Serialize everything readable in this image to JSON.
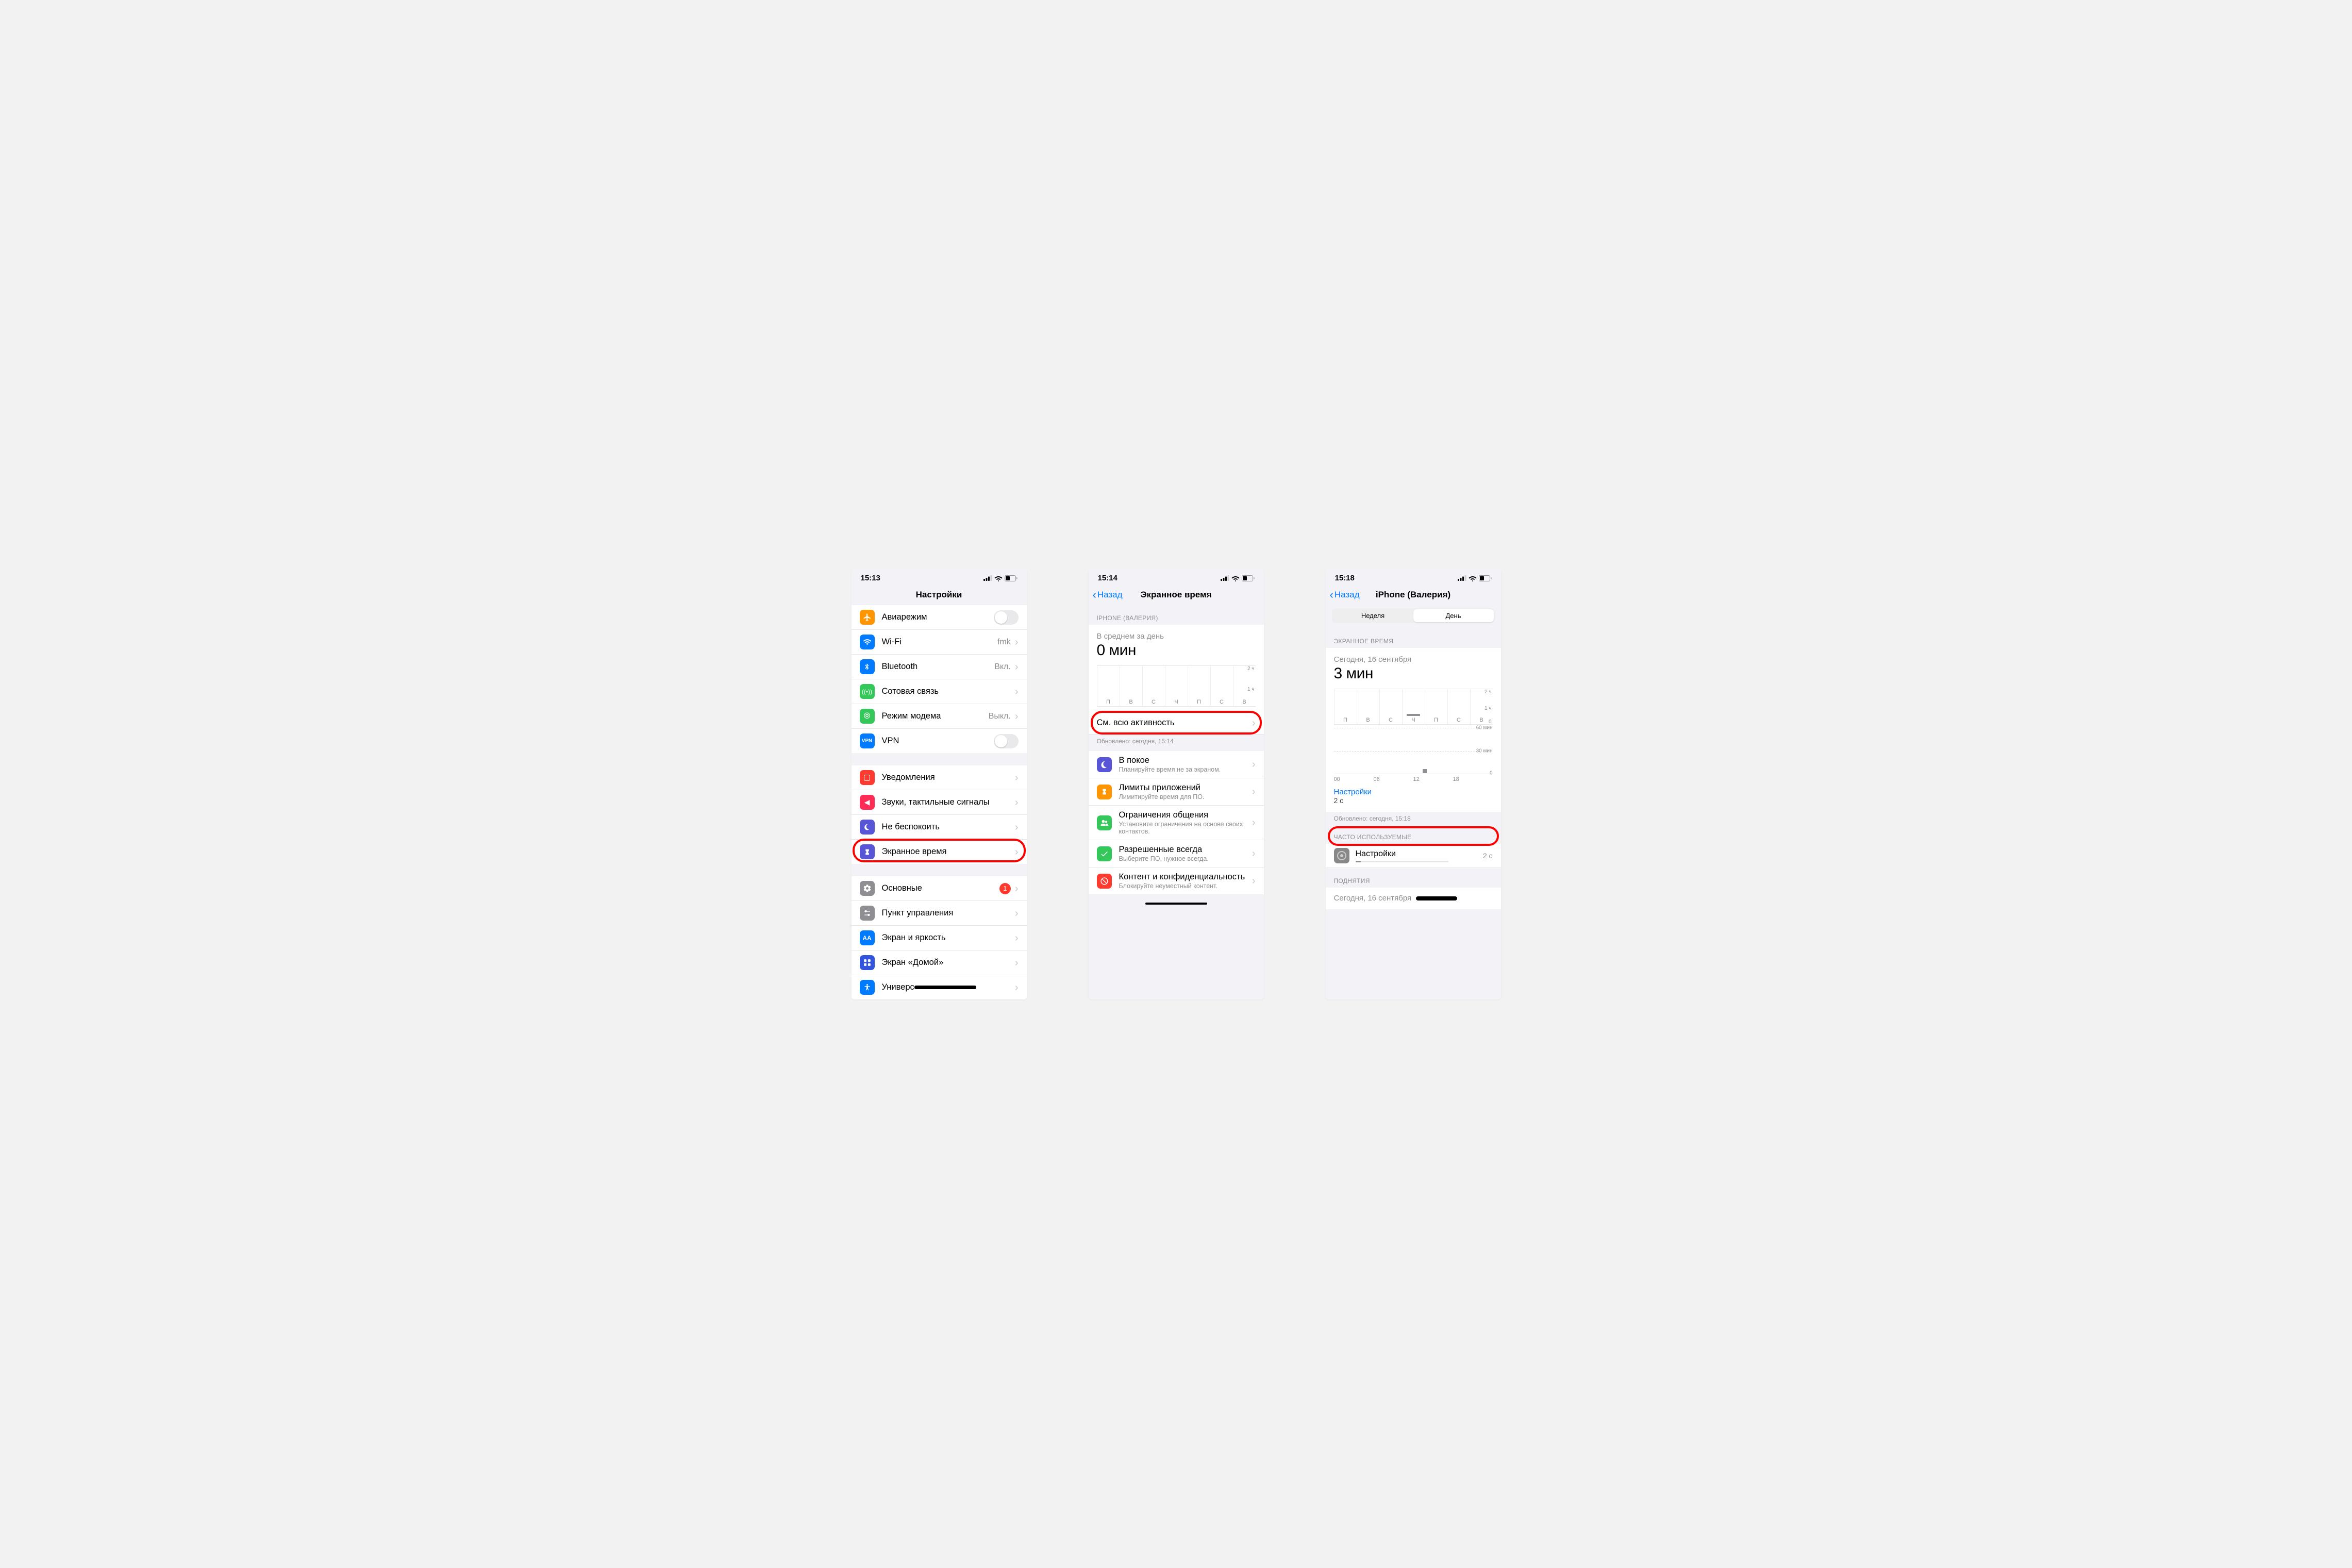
{
  "p1": {
    "time": "15:13",
    "title": "Настройки",
    "group1": [
      {
        "icon": "airplane",
        "color": "#ff9500",
        "label": "Авиарежим",
        "type": "toggle"
      },
      {
        "icon": "wifi",
        "color": "#007aff",
        "label": "Wi-Fi",
        "value": "fmk",
        "chev": true
      },
      {
        "icon": "bluetooth",
        "color": "#007aff",
        "label": "Bluetooth",
        "value": "Вкл.",
        "chev": true
      },
      {
        "icon": "antenna",
        "color": "#34c759",
        "label": "Сотовая связь",
        "chev": true
      },
      {
        "icon": "link",
        "color": "#34c759",
        "label": "Режим модема",
        "value": "Выкл.",
        "chev": true
      },
      {
        "icon": "vpn",
        "color": "#007aff",
        "label": "VPN",
        "type": "toggle"
      }
    ],
    "group2": [
      {
        "icon": "bell",
        "color": "#ff3b30",
        "label": "Уведомления",
        "chev": true
      },
      {
        "icon": "sound",
        "color": "#ff2d55",
        "label": "Звуки, тактильные сигналы",
        "chev": true
      },
      {
        "icon": "moon",
        "color": "#5856d6",
        "label": "Не беспокоить",
        "chev": true
      },
      {
        "icon": "hourglass",
        "color": "#5856d6",
        "label": "Экранное время",
        "chev": true,
        "highlight": true
      }
    ],
    "group3": [
      {
        "icon": "gear",
        "color": "#8e8e93",
        "label": "Основные",
        "badge": "1",
        "chev": true
      },
      {
        "icon": "toggles",
        "color": "#8e8e93",
        "label": "Пункт управления",
        "chev": true
      },
      {
        "icon": "aa",
        "color": "#007aff",
        "label": "Экран и яркость",
        "chev": true
      },
      {
        "icon": "grid",
        "color": "#3355dd",
        "label": "Экран «Домой»",
        "chev": true
      },
      {
        "icon": "access",
        "color": "#007aff",
        "label": "Универсальный доступ",
        "chev": true,
        "redact": true
      }
    ]
  },
  "p2": {
    "time": "15:14",
    "back": "Назад",
    "title": "Экранное время",
    "section_header": "IPHONE (ВАЛЕРИЯ)",
    "avg_label": "В среднем за день",
    "avg_value": "0 мин",
    "days": [
      "П",
      "В",
      "С",
      "Ч",
      "П",
      "С",
      "В"
    ],
    "y_ticks": [
      "2 ч",
      "1 ч"
    ],
    "see_all": "См. всю активность",
    "updated": "Обновлено: сегодня, 15:14",
    "features": [
      {
        "icon": "moon2",
        "color": "#5856d6",
        "label": "В покое",
        "sub": "Планируйте время не за экраном."
      },
      {
        "icon": "hourglass",
        "color": "#ff9500",
        "label": "Лимиты приложений",
        "sub": "Лимитируйте время для ПО."
      },
      {
        "icon": "people",
        "color": "#34c759",
        "label": "Ограничения общения",
        "sub": "Установите ограничения на основе своих контактов."
      },
      {
        "icon": "check",
        "color": "#34c759",
        "label": "Разрешенные всегда",
        "sub": "Выберите ПО, нужное всегда."
      },
      {
        "icon": "block",
        "color": "#ff3b30",
        "label": "Контент и конфиденциальность",
        "sub": "Блокируйте неуместный контент."
      }
    ]
  },
  "p3": {
    "time": "15:18",
    "back": "Назад",
    "title": "iPhone (Валерия)",
    "seg_week": "Неделя",
    "seg_day": "День",
    "section_header": "ЭКРАННОЕ ВРЕМЯ",
    "date": "Сегодня, 16 сентября",
    "value": "3 мин",
    "days": [
      "П",
      "В",
      "С",
      "Ч",
      "П",
      "С",
      "В"
    ],
    "y1": [
      "2 ч",
      "1 ч",
      "0"
    ],
    "hours": [
      "00",
      "06",
      "12",
      "18"
    ],
    "y2": [
      "60 мин",
      "30 мин",
      "0"
    ],
    "app_link": "Настройки",
    "app_time": "2 с",
    "updated": "Обновлено: сегодня, 15:18",
    "freq_header": "ЧАСТО ИСПОЛЬЗУЕМЫЕ",
    "freq_app": "Настройки",
    "freq_time": "2 с",
    "pickups_header": "ПОДНЯТИЯ",
    "pickups_date": "Сегодня, 16 сентября"
  }
}
